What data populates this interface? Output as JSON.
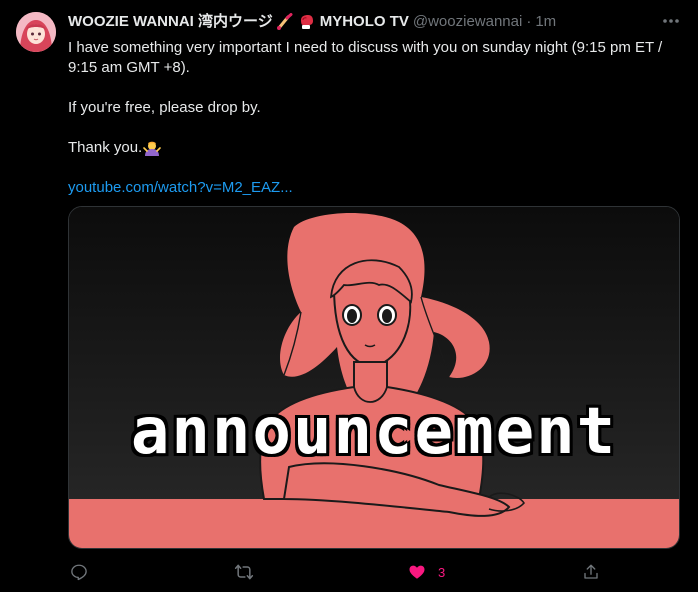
{
  "tweet": {
    "author": {
      "display_name": "WOOZIE WANNAI 湾内ウージ",
      "suffix": "MYHOLO TV",
      "handle": "@wooziewannai",
      "separator": "·",
      "time": "1m"
    },
    "text": {
      "para1": "I have something very important I need to discuss with you on sunday night (9:15 pm ET / 9:15 am GMT +8).",
      "para2": "If you're free, please drop by.",
      "para3": "Thank you.",
      "link": "youtube.com/watch?v=M2_EAZ..."
    },
    "media": {
      "overlay_text": "announcement"
    },
    "actions": {
      "like_count": "3"
    }
  },
  "icons": {
    "more": "more-horizontal-icon",
    "reply": "reply-icon",
    "retweet": "retweet-icon",
    "like": "heart-filled-icon",
    "share": "share-icon",
    "emoji_brush": "paintbrush-emoji",
    "emoji_glove": "boxing-glove-emoji",
    "emoji_bow": "person-bowing-emoji"
  },
  "colors": {
    "background": "#000000",
    "text": "#e7e9ea",
    "muted": "#71767b",
    "link": "#1d9bf0",
    "like": "#f91880",
    "art_pink": "#e8716d"
  }
}
